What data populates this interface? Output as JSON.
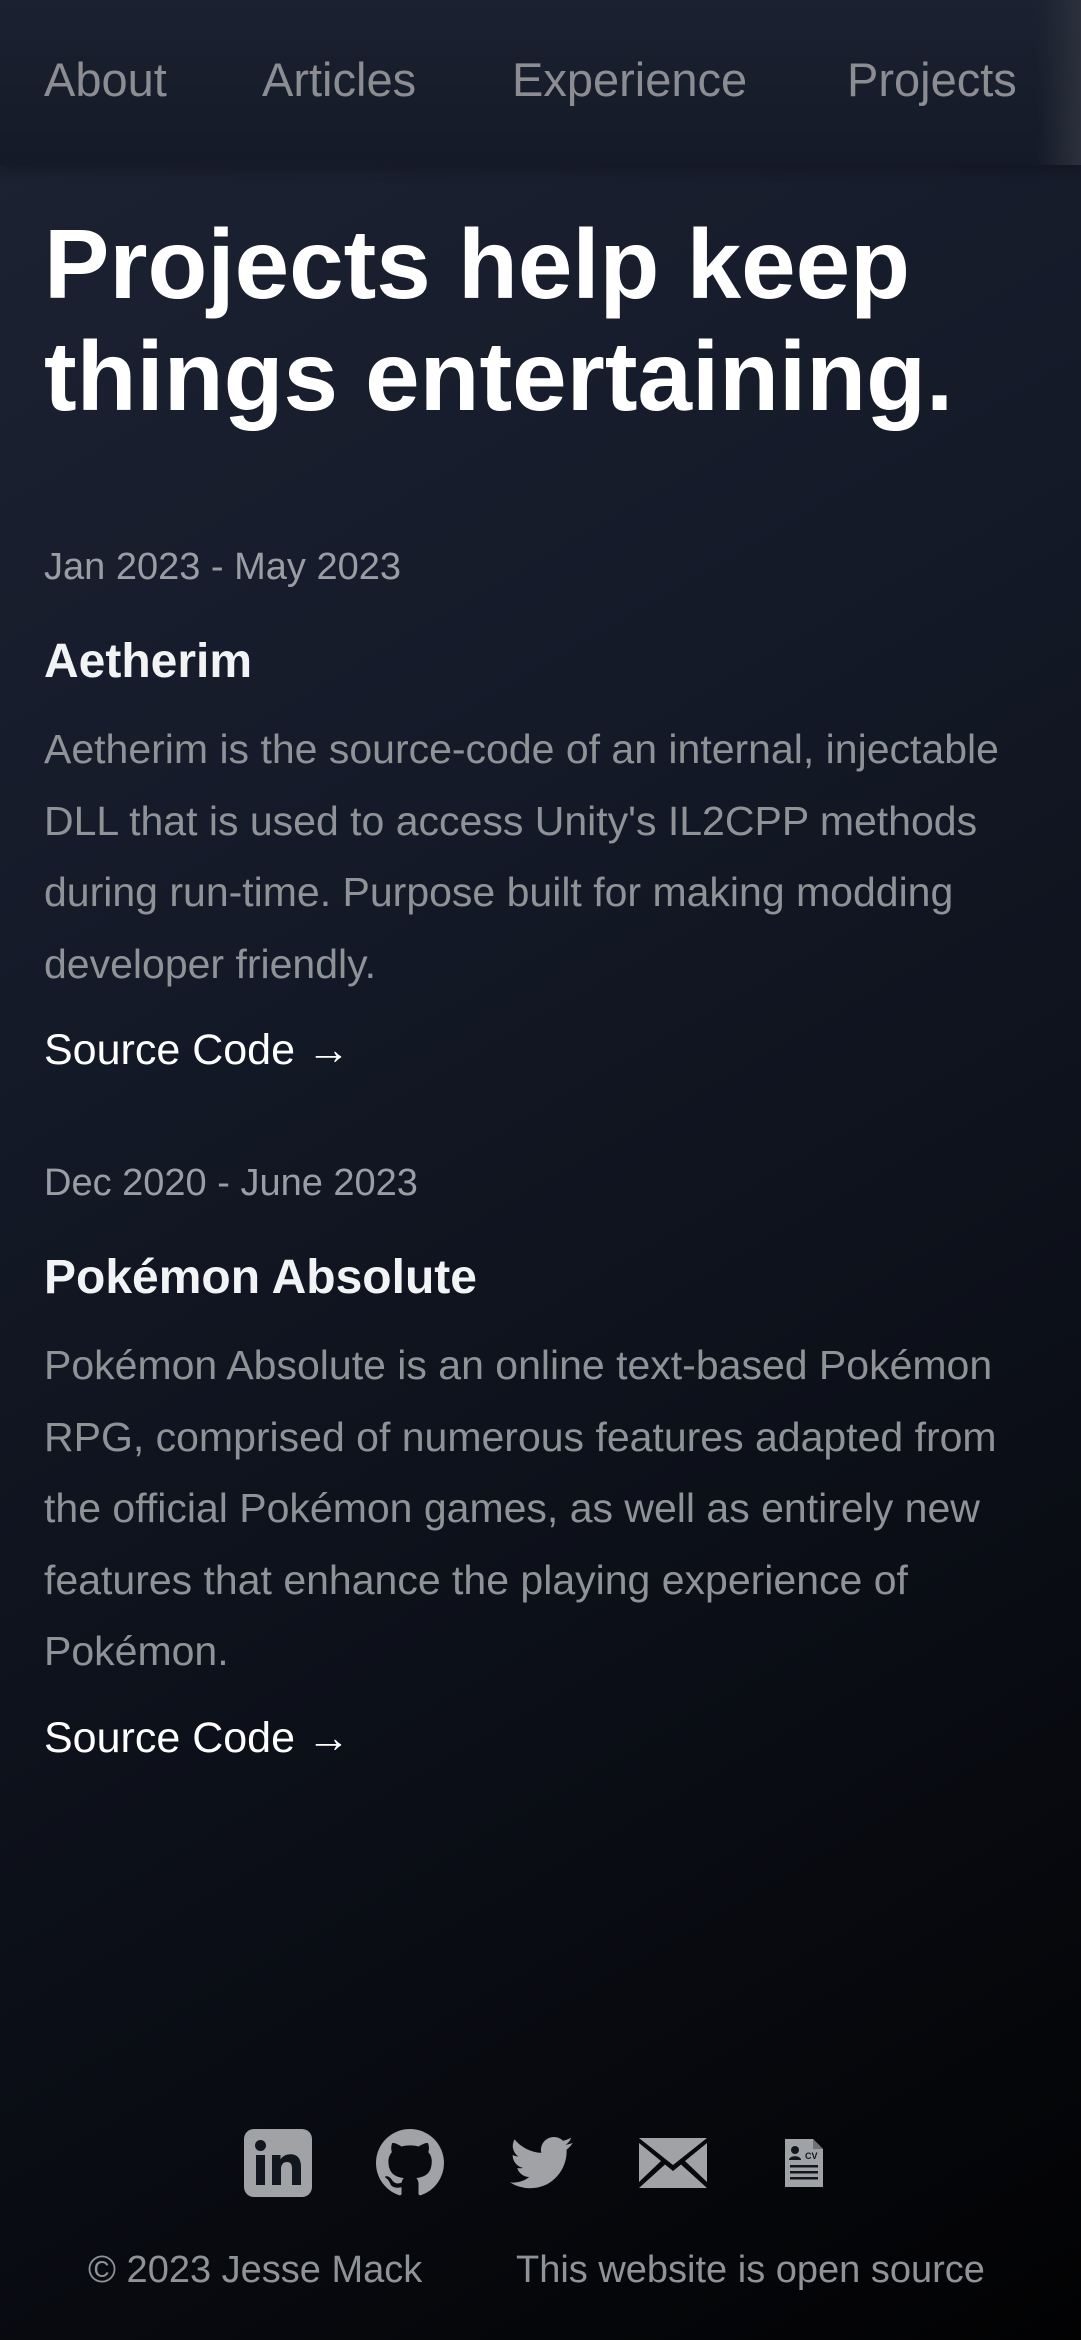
{
  "nav": {
    "items": [
      {
        "label": "About"
      },
      {
        "label": "Articles"
      },
      {
        "label": "Experience"
      },
      {
        "label": "Projects"
      }
    ]
  },
  "headline": "Projects help keep things entertaining.",
  "projects": [
    {
      "date": "Jan 2023 - May 2023",
      "title": "Aetherim",
      "description": "Aetherim is the source-code of an internal, injectable DLL that is used to access Unity's IL2CPP methods during run-time. Purpose built for making modding developer friendly.",
      "link": "Source Code →"
    },
    {
      "date": "Dec 2020 - June 2023",
      "title": "Pokémon Absolute",
      "description": "Pokémon Absolute is an online text-based Pokémon RPG, comprised of numerous features adapted from the official Pokémon games, as well as entirely new features that enhance the playing experience of Pokémon.",
      "link": "Source Code →"
    }
  ],
  "social": [
    {
      "icon": "linkedin-icon"
    },
    {
      "icon": "github-icon"
    },
    {
      "icon": "twitter-icon"
    },
    {
      "icon": "mail-icon"
    },
    {
      "icon": "cv-document-icon"
    }
  ],
  "footer": {
    "copyright": "© 2023 Jesse Mack",
    "open_source": "This website is open source"
  },
  "colors": {
    "text_primary": "#ffffff",
    "text_muted": "#8f9296",
    "icon": "#a0a2a6"
  }
}
